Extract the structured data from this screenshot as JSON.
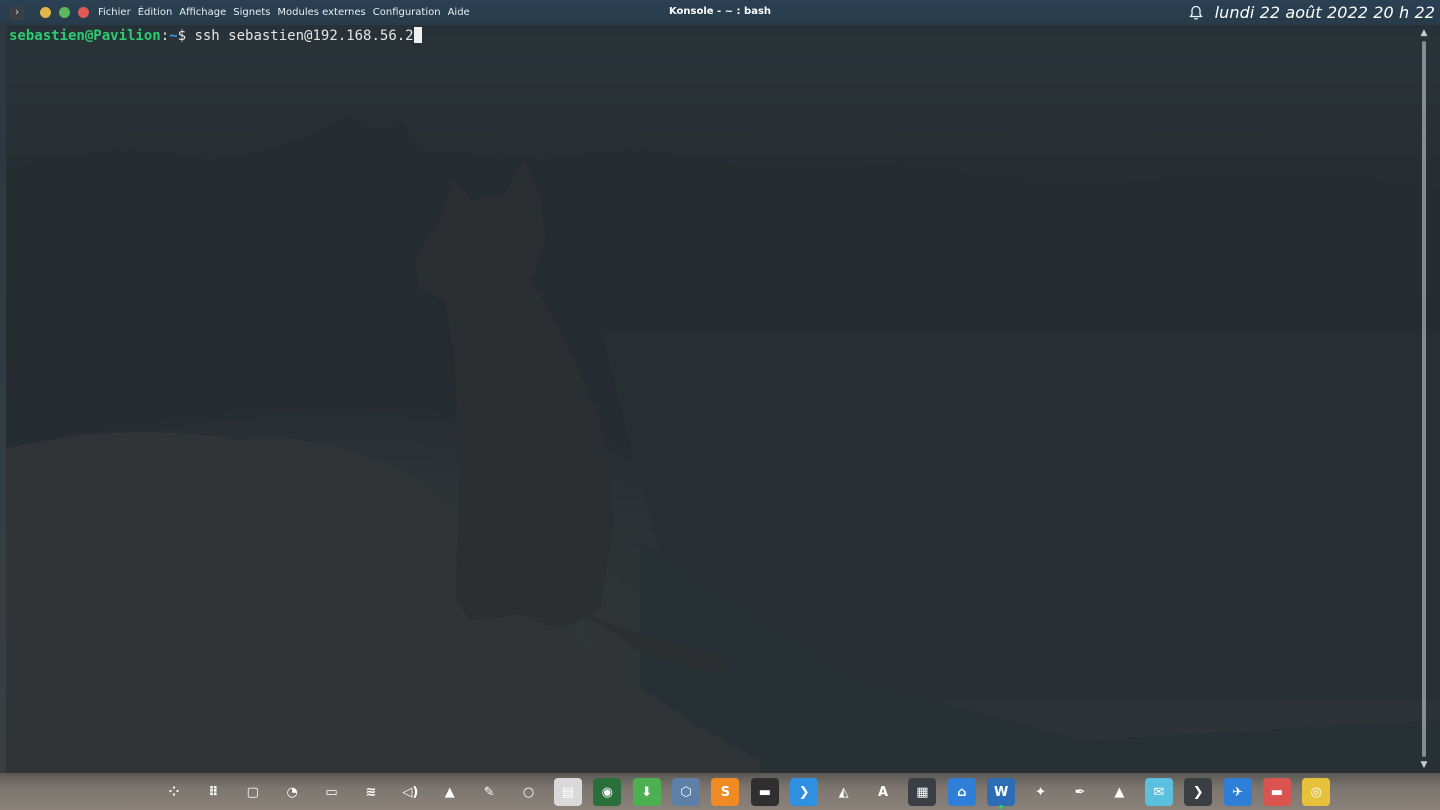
{
  "window": {
    "title": "Konsole - ~ : bash",
    "app_icon": "konsole-icon",
    "buttons": [
      {
        "name": "minimize",
        "color": "#e0b648"
      },
      {
        "name": "maximize",
        "color": "#5cb85c"
      },
      {
        "name": "close",
        "color": "#e05a5a"
      }
    ]
  },
  "menu": {
    "items": [
      "Fichier",
      "Édition",
      "Affichage",
      "Signets",
      "Modules externes",
      "Configuration",
      "Aide"
    ]
  },
  "panel": {
    "notification_icon": "bell-icon",
    "clock": "lundi 22 août 2022  20 h 22"
  },
  "terminal": {
    "user_host": "sebastien@Pavilion",
    "separator": ":",
    "path": "~",
    "prompt_symbol": "$ ",
    "command": "ssh sebastien@192.168.56.2"
  },
  "dock": {
    "items": [
      {
        "name": "activities-icon",
        "glyph": "⁘",
        "bg": "transparent"
      },
      {
        "name": "app-grid-icon",
        "glyph": "⠿",
        "bg": "transparent"
      },
      {
        "name": "show-desktop-icon",
        "glyph": "▢",
        "bg": "transparent"
      },
      {
        "name": "lightbulb-icon",
        "glyph": "◔",
        "bg": "transparent"
      },
      {
        "name": "battery-icon",
        "glyph": "▭",
        "bg": "transparent"
      },
      {
        "name": "wifi-icon",
        "glyph": "≋",
        "bg": "transparent"
      },
      {
        "name": "volume-icon",
        "glyph": "◁)",
        "bg": "transparent"
      },
      {
        "name": "tray-expand-icon",
        "glyph": "▲",
        "bg": "transparent"
      },
      {
        "name": "pen-icon",
        "glyph": "✎",
        "bg": "transparent"
      },
      {
        "name": "circle-icon",
        "glyph": "○",
        "bg": "transparent"
      },
      {
        "name": "files-icon",
        "glyph": "▤",
        "bg": "#d9d9d9"
      },
      {
        "name": "globe-icon",
        "glyph": "◉",
        "bg": "#2a6e3a"
      },
      {
        "name": "installer-icon",
        "glyph": "⬇",
        "bg": "#4caf50"
      },
      {
        "name": "virtualbox-icon",
        "glyph": "⬡",
        "bg": "#5d7fa8"
      },
      {
        "name": "sublime-icon",
        "glyph": "S",
        "bg": "#f08a24"
      },
      {
        "name": "terminal-dark-icon",
        "glyph": "▬",
        "bg": "#2f2f2f"
      },
      {
        "name": "vscode-icon",
        "glyph": "❯",
        "bg": "#2f8fe0"
      },
      {
        "name": "system-monitor-icon",
        "glyph": "◭",
        "bg": "transparent"
      },
      {
        "name": "font-viewer-icon",
        "glyph": "A",
        "bg": "transparent"
      },
      {
        "name": "calculator-icon",
        "glyph": "▦",
        "bg": "#3a3f45"
      },
      {
        "name": "store-icon",
        "glyph": "⌂",
        "bg": "#2f7fd8"
      },
      {
        "name": "word-processor-icon",
        "glyph": "W",
        "bg": "#2c6db5"
      },
      {
        "name": "gimp-icon",
        "glyph": "✦",
        "bg": "transparent"
      },
      {
        "name": "inkscape-icon",
        "glyph": "✒",
        "bg": "transparent"
      },
      {
        "name": "vlc-icon",
        "glyph": "▲",
        "bg": "transparent"
      },
      {
        "name": "mail-icon",
        "glyph": "✉",
        "bg": "#5bc0de"
      },
      {
        "name": "konsole-icon",
        "glyph": "❯",
        "bg": "#3a3f44"
      },
      {
        "name": "network-icon",
        "glyph": "✈",
        "bg": "#2f7fd8"
      },
      {
        "name": "archive-icon",
        "glyph": "▬",
        "bg": "#d9534f"
      },
      {
        "name": "chrome-icon",
        "glyph": "◎",
        "bg": "#e8c13a"
      }
    ]
  }
}
